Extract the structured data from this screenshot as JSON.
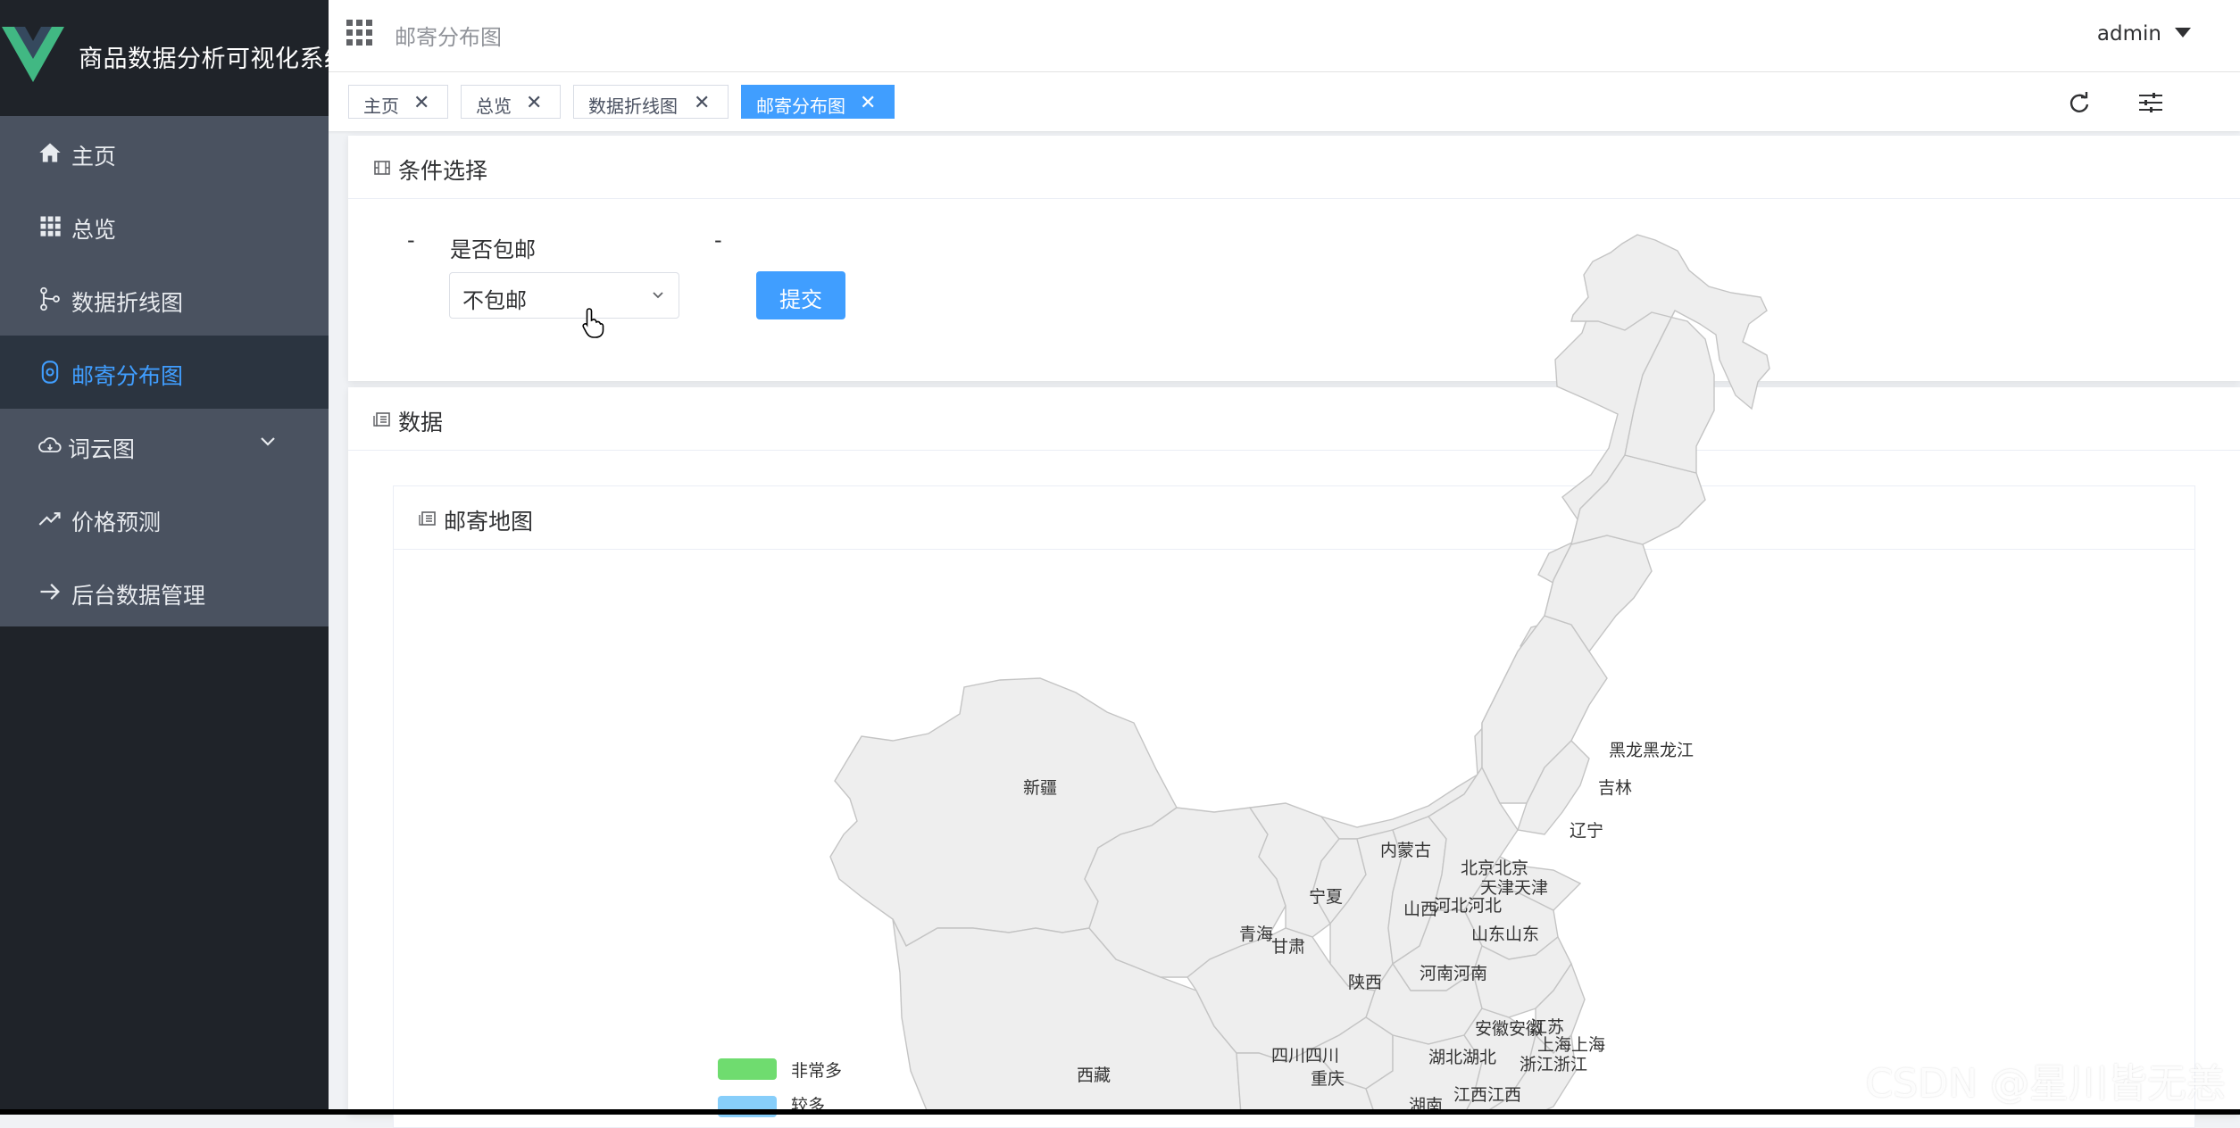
{
  "app": {
    "title": "商品数据分析可视化系统"
  },
  "sidebar": {
    "items": [
      {
        "label": "主页",
        "icon": "home-icon"
      },
      {
        "label": "总览",
        "icon": "grid-icon"
      },
      {
        "label": "数据折线图",
        "icon": "branch-icon"
      },
      {
        "label": "邮寄分布图",
        "icon": "mail-icon",
        "active": true
      },
      {
        "label": "词云图",
        "icon": "cloud-icon",
        "expandable": true
      },
      {
        "label": "价格预测",
        "icon": "trend-icon"
      },
      {
        "label": "后台数据管理",
        "icon": "arrow-right-icon"
      }
    ]
  },
  "header": {
    "breadcrumb": "邮寄分布图",
    "user": "admin"
  },
  "tags": [
    {
      "label": "主页"
    },
    {
      "label": "总览"
    },
    {
      "label": "数据折线图"
    },
    {
      "label": "邮寄分布图",
      "active": true
    }
  ],
  "filter_card": {
    "title": "条件选择",
    "dash": "-",
    "field_label": "是否包邮",
    "select_value": "不包邮",
    "submit_label": "提交"
  },
  "data_card": {
    "title": "数据",
    "map_title": "邮寄地图",
    "provinces": [
      "新疆",
      "西藏",
      "青海",
      "甘肃",
      "宁夏",
      "内蒙古",
      "陕西",
      "四川四川",
      "重庆",
      "山西",
      "河北河北",
      "北京北京",
      "天津天津",
      "山东山东",
      "河南河南",
      "湖北湖北",
      "湖南",
      "江西江西",
      "安徽安徽",
      "江苏",
      "上海上海",
      "浙江浙江",
      "辽宁",
      "吉林",
      "黑龙黑龙江"
    ],
    "legend": [
      {
        "label": "非常多",
        "color": "#6fdc6f"
      },
      {
        "label": "较多",
        "color": "#87cefa"
      }
    ]
  },
  "watermark": "CSDN @星川皆无恙",
  "colors": {
    "accent": "#409eff",
    "sidebar_bg": "#1f2329",
    "menu_bg": "#4a5260",
    "map_fill": "#eeeeee"
  }
}
